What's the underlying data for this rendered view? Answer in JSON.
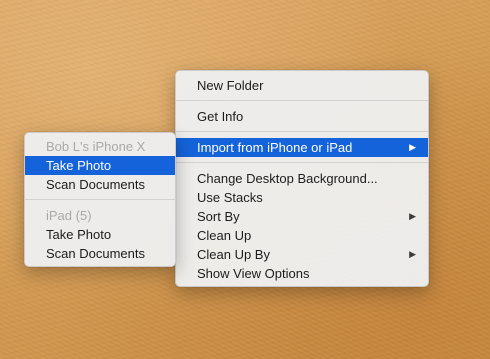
{
  "context_menu": {
    "items": [
      {
        "label": "New Folder"
      },
      {
        "label": "Get Info"
      },
      {
        "label": "Import from iPhone or iPad",
        "has_submenu": true,
        "selected": true
      },
      {
        "label": "Change Desktop Background..."
      },
      {
        "label": "Use Stacks"
      },
      {
        "label": "Sort By",
        "has_submenu": true
      },
      {
        "label": "Clean Up"
      },
      {
        "label": "Clean Up By",
        "has_submenu": true
      },
      {
        "label": "Show View Options"
      }
    ],
    "arrow_glyph": "▶"
  },
  "submenu": {
    "groups": [
      {
        "header": "Bob L's iPhone X",
        "items": [
          {
            "label": "Take Photo",
            "selected": true
          },
          {
            "label": "Scan Documents"
          }
        ]
      },
      {
        "header": "iPad (5)",
        "items": [
          {
            "label": "Take Photo"
          },
          {
            "label": "Scan Documents"
          }
        ]
      }
    ]
  },
  "colors": {
    "selection": "#1463da",
    "desktop": "#d29a52",
    "menu_bg": "#eeeeee",
    "disabled_text": "#a9a9a9"
  },
  "icons": {
    "submenu_arrow": "chevron-right-icon"
  }
}
